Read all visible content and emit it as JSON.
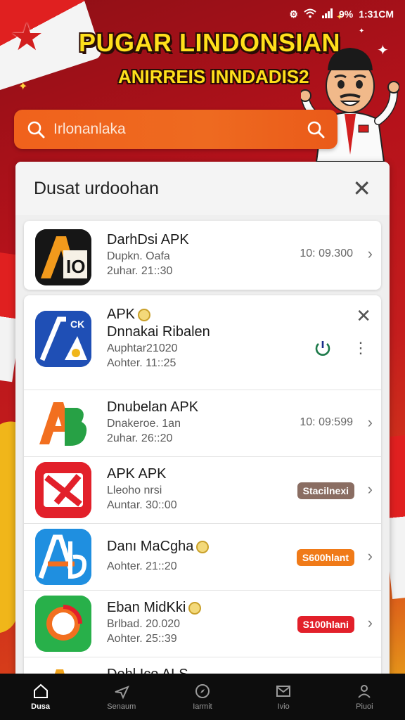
{
  "status_bar": {
    "time": "1:31CM",
    "signal_text": "9%"
  },
  "banner": {
    "title": "PUGAR LINDONSIAN",
    "subtitle": "ANIRREIS INNDADIS2"
  },
  "search": {
    "placeholder": "Irlonanlaka"
  },
  "panel": {
    "title": "Dusat urdoohan",
    "featured": {
      "name": "DarhDsi APK",
      "line1": "Dupkn. Oafa",
      "line2": "2uhar. 21::30",
      "meta": "10: 09.300"
    },
    "items": [
      {
        "name": "APK",
        "name2": "Dnnakai Ribalen",
        "line1": "Auphtar21020",
        "line2": "Aohter. 11::25",
        "icon": "blue-a-ck-icon"
      },
      {
        "name": "Dnubelan APK",
        "line1": "Dnakeroe. 1an",
        "line2": "2uhar. 26::20",
        "meta": "10: 09:599",
        "icon": "ab-green-orange-icon"
      },
      {
        "name": "APK APK",
        "line1": "Lleoho nrsi",
        "line2": "Auntar. 30::00",
        "badge": "Stacilnexi",
        "badge_color": "#8a6d62",
        "icon": "red-x-icon"
      },
      {
        "name": "Danı MaCgha",
        "line1": "Aohter. 21::20",
        "badge": "S600hlant",
        "badge_color": "#f07a18",
        "icon": "blue-ab-icon"
      },
      {
        "name": "Eban MidKki",
        "line1": "Brlbad. 20.020",
        "line2": "Aohter. 25::39",
        "badge": "S100hlani",
        "badge_color": "#e2202a",
        "icon": "green-ring-icon"
      },
      {
        "name": "Dehl Ico ALS",
        "icon": "partial-icon"
      }
    ]
  },
  "bottom_nav": [
    {
      "label": "Dusa",
      "icon": "home-icon",
      "active": true
    },
    {
      "label": "Senaum",
      "icon": "plane-icon",
      "active": false
    },
    {
      "label": "Iarmit",
      "icon": "compass-icon",
      "active": false
    },
    {
      "label": "Ivio",
      "icon": "mail-icon",
      "active": false
    },
    {
      "label": "Piuoi",
      "icon": "profile-icon",
      "active": false
    }
  ],
  "colors": {
    "accent_orange": "#f0621c",
    "background_red": "#b5121b",
    "banner_yellow": "#ffe01b"
  }
}
